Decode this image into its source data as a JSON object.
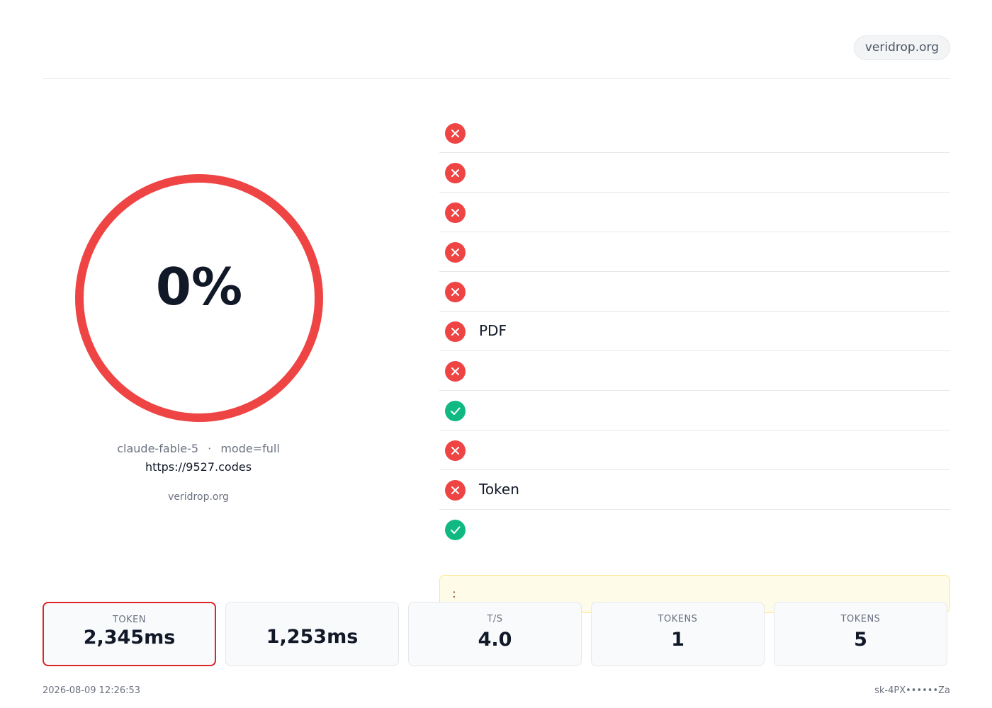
{
  "header": {
    "title": "",
    "domain": "veridrop.org"
  },
  "score": {
    "value_text": "0%",
    "percent": 0,
    "label": "",
    "ring_color": "#ef4444"
  },
  "model": {
    "name": "claude-fable-5",
    "separator": "·",
    "mode": "mode=full",
    "url": "https://9527.codes",
    "powered_by": " veridrop.org "
  },
  "checks": [
    {
      "label": "",
      "status": "",
      "passed": false,
      "icon": "x-circle-icon"
    },
    {
      "label": "",
      "status": "",
      "passed": false,
      "icon": "x-circle-icon"
    },
    {
      "label": "",
      "status": "",
      "passed": false,
      "icon": "x-circle-icon"
    },
    {
      "label": "",
      "status": "",
      "passed": false,
      "icon": "x-circle-icon"
    },
    {
      "label": "",
      "status": "",
      "passed": false,
      "icon": "x-circle-icon"
    },
    {
      "label": "PDF ",
      "status": "",
      "passed": false,
      "icon": "x-circle-icon"
    },
    {
      "label": "",
      "status": "",
      "passed": false,
      "icon": "x-circle-icon"
    },
    {
      "label": "",
      "status": "",
      "passed": true,
      "icon": "check-circle-icon"
    },
    {
      "label": "",
      "status": "",
      "passed": false,
      "icon": "x-circle-icon"
    },
    {
      "label": "Token ",
      "status": "",
      "passed": false,
      "icon": "x-circle-icon"
    },
    {
      "label": "",
      "status": "",
      "passed": true,
      "icon": "check-circle-icon"
    }
  ],
  "alert": {
    "text": ": "
  },
  "stats": [
    {
      "label": " TOKEN",
      "value": "2,345ms",
      "highlight": true
    },
    {
      "label": "",
      "value": "1,253ms",
      "highlight": false
    },
    {
      "label": " T/S",
      "value": "4.0",
      "highlight": false
    },
    {
      "label": " TOKENS",
      "value": "1",
      "highlight": false
    },
    {
      "label": " TOKENS",
      "value": "5",
      "highlight": false
    }
  ],
  "footer": {
    "left": " 2026-08-09 12:26:53 ",
    "right": " sk-4PX••••••Za"
  },
  "colors": {
    "fail": "#dc2626",
    "pass": "#10b981",
    "alert_bg": "#fefce8"
  }
}
